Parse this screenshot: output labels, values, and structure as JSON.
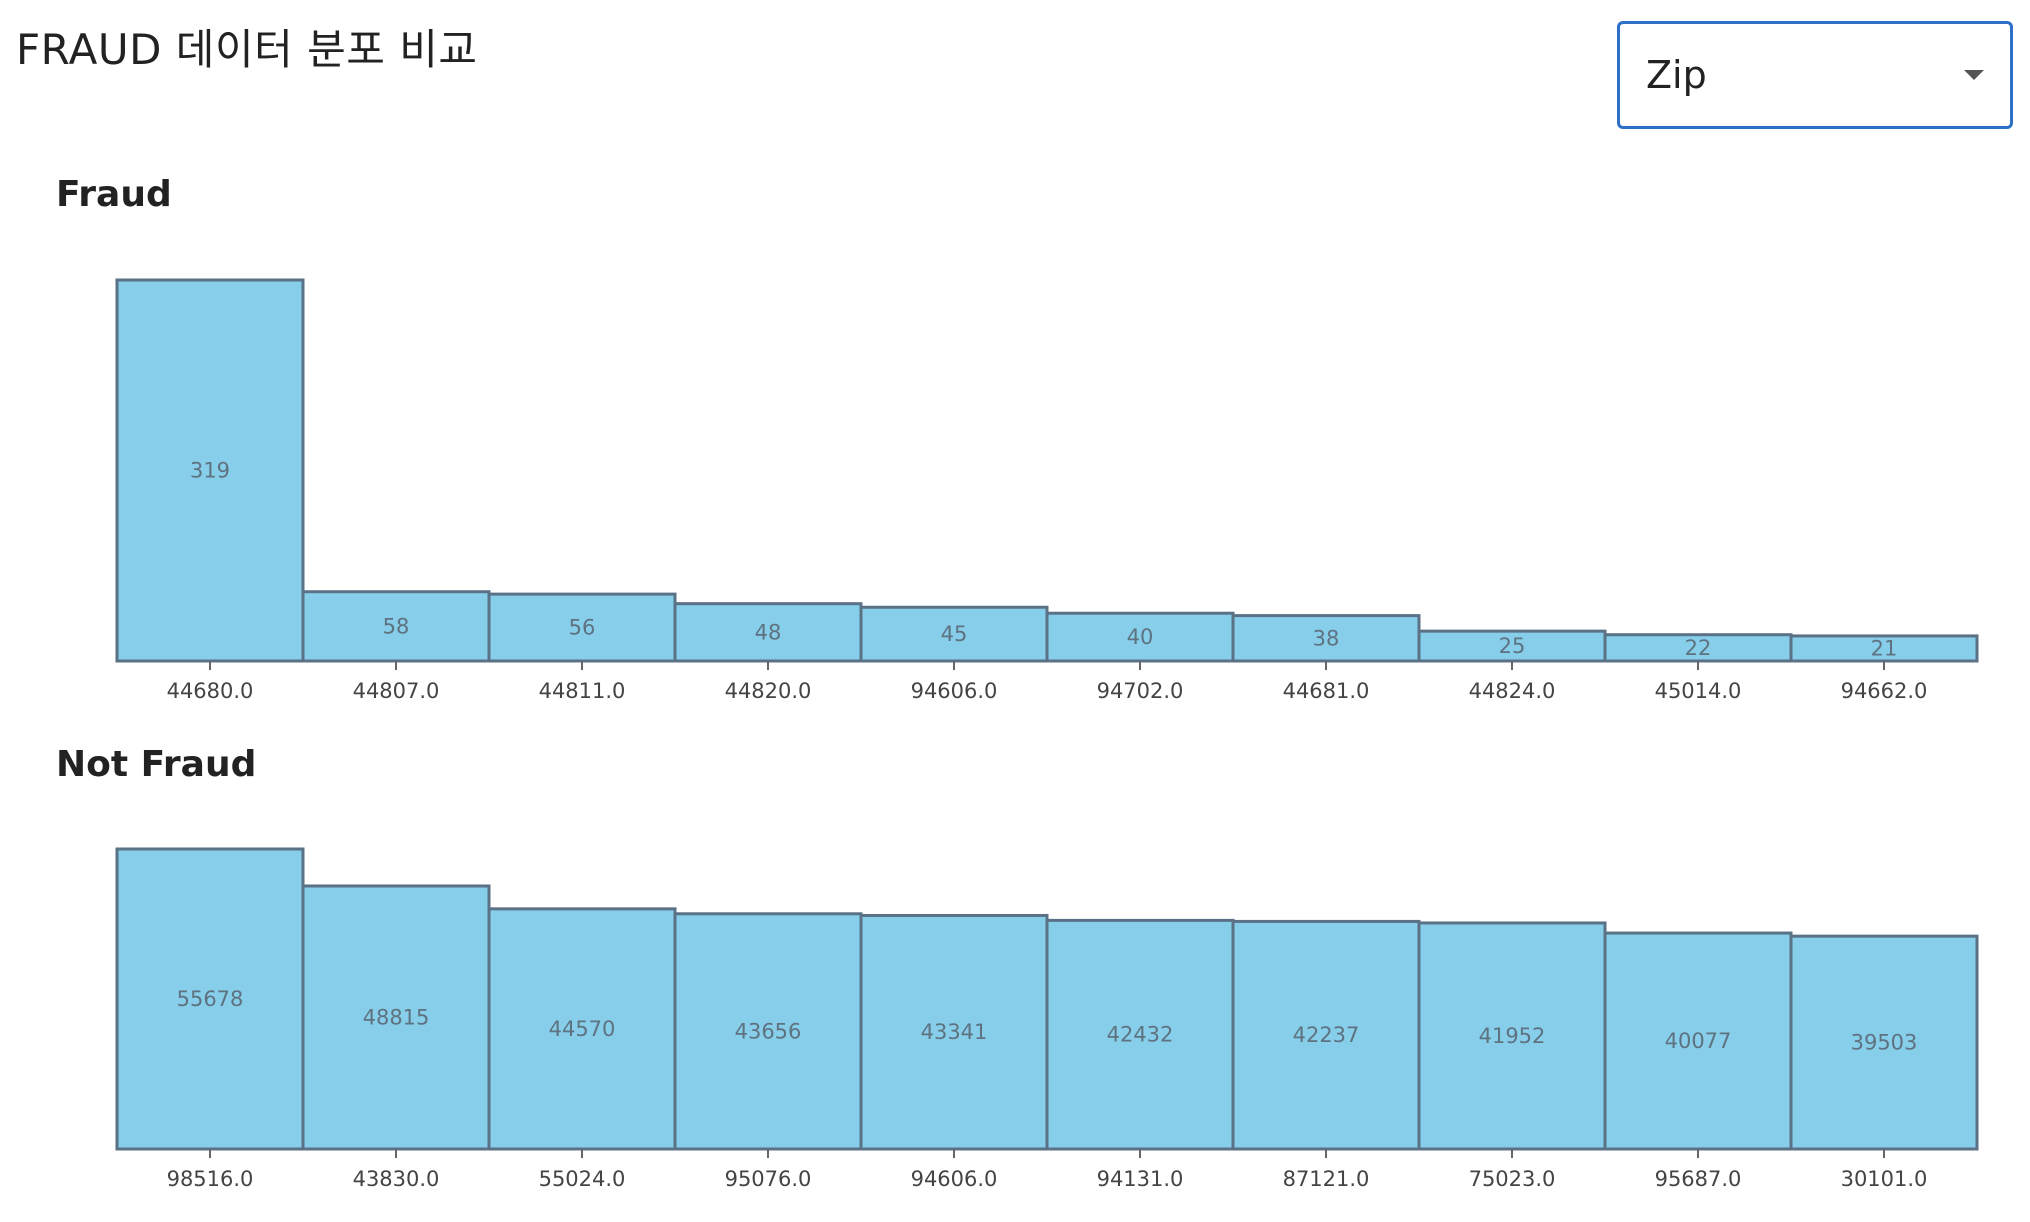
{
  "page": {
    "title": "FRAUD 데이터 분포 비교"
  },
  "selector": {
    "selected": "Zip",
    "icon": "chevron-down-icon"
  },
  "colors": {
    "bar_fill": "#87ceeb",
    "bar_stroke": "#5a7186",
    "select_border": "#2e6fc8"
  },
  "chart_data": [
    {
      "type": "bar",
      "title": "Fraud",
      "categories": [
        "44680.0",
        "44807.0",
        "44811.0",
        "44820.0",
        "94606.0",
        "94702.0",
        "44681.0",
        "44824.0",
        "45014.0",
        "94662.0"
      ],
      "values": [
        319,
        58,
        56,
        48,
        45,
        40,
        38,
        25,
        22,
        21
      ],
      "xlabel": "",
      "ylabel": "",
      "ylim": [
        0,
        319
      ],
      "grid": false
    },
    {
      "type": "bar",
      "title": "Not Fraud",
      "categories": [
        "98516.0",
        "43830.0",
        "55024.0",
        "95076.0",
        "94606.0",
        "94131.0",
        "87121.0",
        "75023.0",
        "95687.0",
        "30101.0"
      ],
      "values": [
        55678,
        48815,
        44570,
        43656,
        43341,
        42432,
        42237,
        41952,
        40077,
        39503
      ],
      "xlabel": "",
      "ylabel": "",
      "ylim": [
        0,
        55678
      ],
      "grid": false
    }
  ]
}
